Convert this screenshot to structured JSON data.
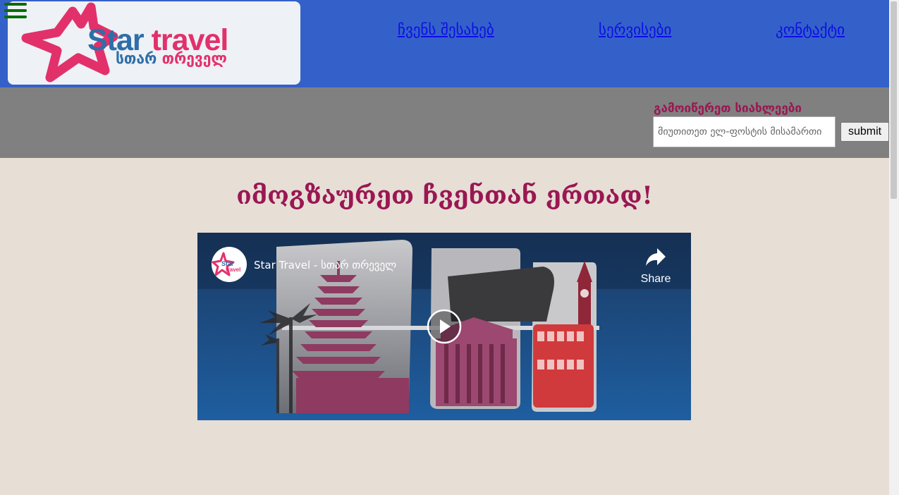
{
  "header": {
    "menu_icon": "hamburger-menu-icon",
    "logo": {
      "text_en_1": "Star",
      "text_en_2": "travel",
      "text_ka_1": "სთარ",
      "text_ka_2": "თრეველ"
    },
    "nav": [
      {
        "label": "ჩვენს შესახებ"
      },
      {
        "label": "სერვისები"
      },
      {
        "label": "კონტაქტი"
      }
    ]
  },
  "newsletter": {
    "label": "გამოიწერეთ სიახლეები",
    "placeholder": "მიუთითეთ ელ-ფოსტის მისამართი",
    "value": "",
    "submit_label": "submit"
  },
  "main": {
    "title": "იმოგზაურეთ ჩვენთან ერთად!"
  },
  "video": {
    "title": "Star Travel - სთარ თრეველ",
    "share_label": "Share",
    "share_icon": "share-arrow-icon",
    "play_icon": "play-icon",
    "avatar_text_1": "Star",
    "avatar_text_2": "travel"
  },
  "colors": {
    "header_bg": "#3461c9",
    "band_bg": "#808080",
    "page_bg": "#e7ded6",
    "accent": "#9a1752",
    "link": "#0d0de6",
    "logo_blue": "#2f6ea8",
    "logo_pink": "#e2306b",
    "menu_icon": "#0a6b0a"
  }
}
